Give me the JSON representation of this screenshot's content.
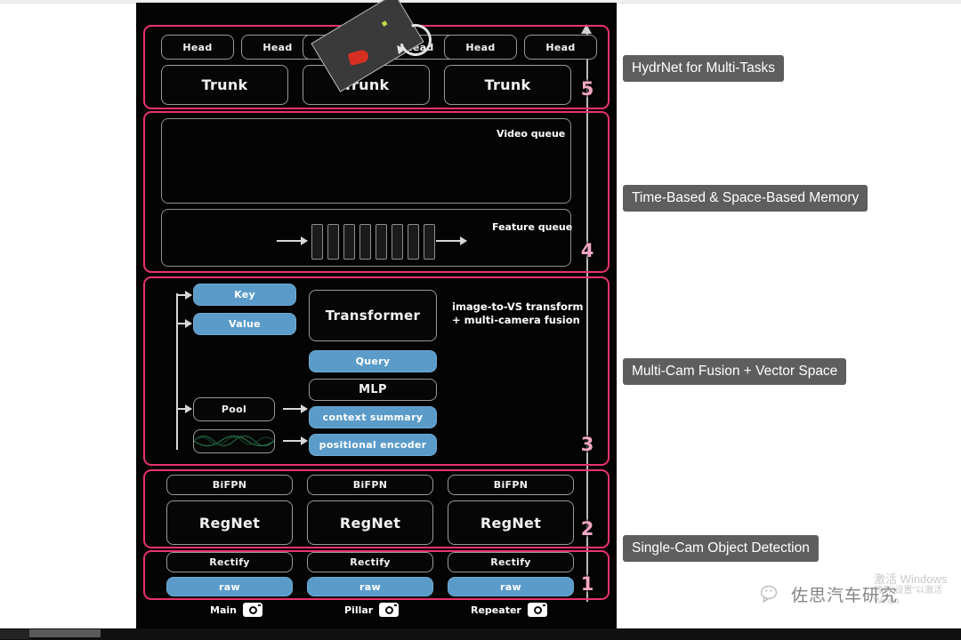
{
  "slide": {
    "axis": {
      "name": "stage-progress-arrow",
      "numbers": [
        "5",
        "4",
        "3",
        "2",
        "1"
      ]
    },
    "stage5": {
      "id": "5",
      "heads": [
        "Head",
        "Head",
        "Head",
        "Head",
        "Head",
        "Head"
      ],
      "trunks": [
        "Trunk",
        "Trunk",
        "Trunk"
      ]
    },
    "stage4": {
      "id": "4",
      "video_queue_label": "Video queue",
      "feature_queue_label": "Feature queue",
      "feature_tick_count": 8
    },
    "stage3": {
      "id": "3",
      "key": "Key",
      "value": "Value",
      "pool": "Pool",
      "transformer": "Transformer",
      "query": "Query",
      "mlp": "MLP",
      "context_summary": "context summary",
      "positional_encoder": "positional encoder",
      "note_line1": "image-to-VS transform",
      "note_line2": "+ multi-camera fusion"
    },
    "stage2": {
      "id": "2",
      "bifpn": [
        "BiFPN",
        "BiFPN",
        "BiFPN"
      ],
      "regnet": [
        "RegNet",
        "RegNet",
        "RegNet"
      ]
    },
    "stage1": {
      "id": "1",
      "rectify": [
        "Rectify",
        "Rectify",
        "Rectify"
      ],
      "raw": [
        "raw",
        "raw",
        "raw"
      ]
    },
    "cameras": [
      {
        "label": "Main",
        "icon": "camera-icon"
      },
      {
        "label": "Pillar",
        "icon": "camera-icon"
      },
      {
        "label": "Repeater",
        "icon": "camera-icon"
      }
    ]
  },
  "callouts": [
    {
      "id": "hydrnet",
      "text": "HydrNet for Multi-Tasks"
    },
    {
      "id": "memory",
      "text": "Time-Based & Space-Based Memory"
    },
    {
      "id": "fusion",
      "text": "Multi-Cam Fusion + Vector Space"
    },
    {
      "id": "detection",
      "text": "Single-Cam Object Detection"
    }
  ],
  "credit": {
    "logo_icon": "wechat-logo-icon",
    "text": "佐思汽车研究"
  },
  "watermark": {
    "line1": "激活 Windows",
    "line2": "转到\"设置\"以激活 Windo"
  },
  "colors": {
    "stage_frame": "#e8336d",
    "block_blue": "#5b9bc9",
    "canvas": "#040404",
    "callout_bg": "#5e5e5e",
    "axis_number": "#f4a7c4"
  }
}
